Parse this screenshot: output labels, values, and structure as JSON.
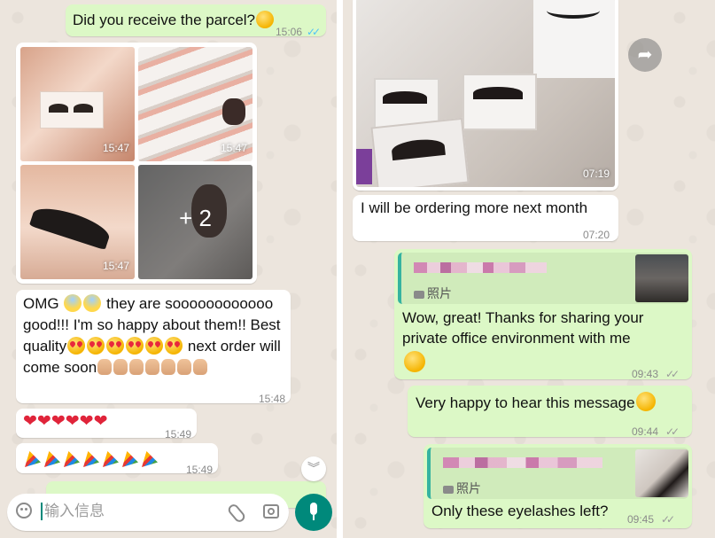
{
  "left_chat": {
    "msg_parcel": {
      "text": "Did you receive the parcel?",
      "time": "15:06",
      "ticks": "✓✓"
    },
    "album": {
      "photos": [
        {
          "time": "15:47"
        },
        {
          "time": "15:47"
        },
        {
          "time": "15:47"
        },
        {
          "more": "+ 2"
        }
      ]
    },
    "msg_omg": {
      "part1": "OMG ",
      "part2": " they are soooooooooooo good!!! I'm so happy about them!! Best quality",
      "part3": " next order will come soon",
      "time": "15:48"
    },
    "msg_hearts": {
      "hearts": "❤❤❤❤❤❤",
      "time": "15:49"
    },
    "msg_party": {
      "time": "15:49"
    },
    "input": {
      "placeholder": "输入信息"
    },
    "icons": {
      "emoji": "smiley-icon",
      "attach": "paperclip-icon",
      "camera": "camera-icon",
      "mic": "microphone-icon",
      "scroll": "chevron-double-down-icon"
    }
  },
  "right_chat": {
    "image_msg": {
      "time": "07:19"
    },
    "msg_ordering": {
      "text": "I will be ordering more next month",
      "time": "07:20"
    },
    "reply1": {
      "quote_label": "照片",
      "text": "Wow, great! Thanks for sharing your private office environment with me",
      "time": "09:43",
      "ticks": "✓✓"
    },
    "msg_happy": {
      "text": "Very happy to hear this message",
      "time": "09:44",
      "ticks": "✓✓"
    },
    "reply2": {
      "quote_label": "照片",
      "text": "Only these eyelashes left?",
      "time": "09:45",
      "ticks": "✓✓"
    },
    "icons": {
      "forward": "forward-arrow-icon"
    }
  },
  "colors": {
    "outgoing": "#dcf8c6",
    "incoming": "#ffffff",
    "background": "#ece5dd",
    "accent": "#00897b",
    "read_ticks": "#4fc3f7"
  }
}
